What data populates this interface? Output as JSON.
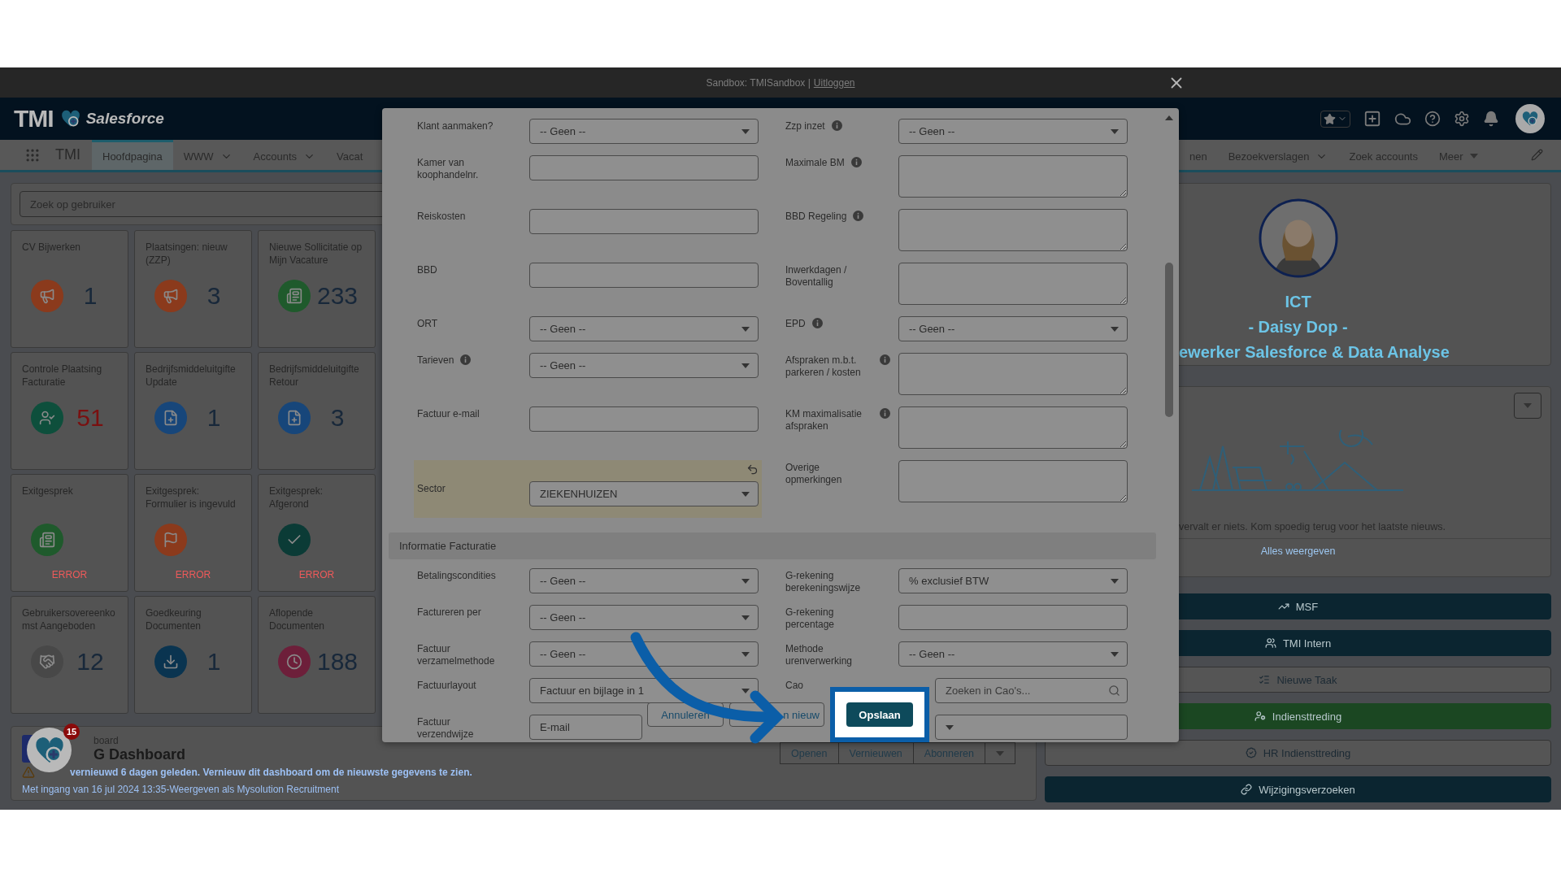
{
  "sandbox_bar": {
    "text": "Sandbox: TMISandbox |",
    "link": "Uitloggen"
  },
  "header": {
    "logo_text": "TMI",
    "logo_product": "Salesforce"
  },
  "nav": {
    "app_name": "TMI",
    "tabs_left": [
      {
        "label": "Hoofdpagina",
        "selected": true,
        "kind": "plain"
      },
      {
        "label": "WWW",
        "selected": false,
        "kind": "dropdown"
      },
      {
        "label": "Accounts",
        "selected": false,
        "kind": "dropdown"
      },
      {
        "label": "Vacat",
        "selected": false,
        "kind": "plain"
      }
    ],
    "tabs_right": [
      {
        "label": "nen",
        "selected": false,
        "kind": "plain"
      },
      {
        "label": "Bezoekverslagen",
        "selected": false,
        "kind": "dropdown"
      },
      {
        "label": "Zoek accounts",
        "selected": false,
        "kind": "plain"
      },
      {
        "label": "Meer",
        "selected": false,
        "kind": "overflow"
      }
    ]
  },
  "search": {
    "placeholder": "Zoek op gebruiker"
  },
  "tiles": [
    {
      "title": "CV Bijwerken",
      "color": "#8b3a1c",
      "value": "1",
      "alert": false
    },
    {
      "title": "Plaatsingen: nieuw (ZZP)",
      "color": "#8b3a1c",
      "value": "3",
      "alert": false
    },
    {
      "title": "Nieuwe Sollicitatie op Mijn Vacature",
      "color": "#1f5a2c",
      "value": "233",
      "alert": false
    },
    {
      "title": "Controle Plaatsing Facturatie",
      "color": "#0e4f3c",
      "value": "51",
      "alert": true
    },
    {
      "title": "Bedrijfsmiddeluitgifte Update",
      "color": "#17467a",
      "value": "1",
      "alert": false
    },
    {
      "title": "Bedrijfsmiddeluitgifte Retour",
      "color": "#17467a",
      "value": "3",
      "alert": false
    },
    {
      "title": "Exitgesprek",
      "color": "#1f5a2c",
      "status": "ERROR",
      "alert": true
    },
    {
      "title": "Exitgesprek: Formulier is ingevuld",
      "color": "#8b3a1c",
      "status": "ERROR",
      "alert": true
    },
    {
      "title": "Exitgesprek: Afgerond",
      "color": "#0b3b36",
      "status": "ERROR",
      "alert": true
    },
    {
      "title": "Gebruikersovereenkomst Aangeboden",
      "color": "#484848",
      "value": "12",
      "alert": false
    },
    {
      "title": "Goedkeuring Documenten",
      "color": "#0a3450",
      "value": "1",
      "alert": false
    },
    {
      "title": "Aflopende Documenten",
      "color": "#6d1f3a",
      "value": "188",
      "alert": false
    }
  ],
  "dashboard": {
    "caption": "board",
    "title": "G Dashboard",
    "warning": "vernieuwd 6 dagen geleden. Vernieuw dit dashboard om de nieuwste gegevens te zien.",
    "note": "Met ingang van 16 jul 2024 13:35-Weergeven als Mysolution Recruitment",
    "buttons": [
      "Openen",
      "Vernieuwen",
      "Abonneren"
    ]
  },
  "bubble": {
    "badge": "15"
  },
  "profile": {
    "department": "ICT",
    "name": "- Daisy Dop -",
    "role": "ewerker Salesforce & Data Analyse"
  },
  "news": {
    "message": "vervalt er niets. Kom spoedig terug voor het laatste nieuws.",
    "link": "Alles weergeven"
  },
  "actions": [
    {
      "label": "MSF",
      "kind": "solid",
      "color": "#0b2530"
    },
    {
      "label": "TMI Intern",
      "kind": "solid",
      "color": "#0b2530"
    },
    {
      "label": "Nieuwe Taak",
      "kind": "outline",
      "color": "#555555"
    },
    {
      "label": "Indiensttreding",
      "kind": "success",
      "color": "#1b4722"
    },
    {
      "label": "HR Indiensttreding",
      "kind": "outline",
      "color": "#555555"
    },
    {
      "label": "Wijzigingsverzoeken",
      "kind": "solid",
      "color": "#0b2530"
    }
  ],
  "modal": {
    "rows": [
      {
        "left": {
          "label": "Klant aanmaken?",
          "kind": "select",
          "value": "-- Geen --",
          "info": false,
          "edited": false
        },
        "right": {
          "label": "Zzp inzet",
          "kind": "select",
          "value": "-- Geen --",
          "info": true,
          "edited": false
        }
      },
      {
        "left": {
          "label": "Kamer van koophandelnr.",
          "kind": "input",
          "info": false,
          "edited": false
        },
        "right": {
          "label": "Maximale BM",
          "kind": "textarea",
          "info": true,
          "edited": false
        }
      },
      {
        "left": {
          "label": "Reiskosten",
          "kind": "input",
          "info": false,
          "edited": false
        },
        "right": {
          "label": "BBD Regeling",
          "kind": "textarea",
          "info": true,
          "edited": false
        }
      },
      {
        "left": {
          "label": "BBD",
          "kind": "input",
          "info": false,
          "edited": false
        },
        "right": {
          "label": "Inwerkdagen / Boventallig",
          "kind": "textarea",
          "info": false,
          "edited": false
        }
      },
      {
        "left": {
          "label": "ORT",
          "kind": "select",
          "value": "-- Geen --",
          "info": false,
          "edited": false
        },
        "right": {
          "label": "EPD",
          "kind": "select",
          "value": "-- Geen --",
          "info": true,
          "edited": false
        }
      },
      {
        "left": {
          "label": "Tarieven",
          "kind": "select",
          "value": "-- Geen --",
          "info": true,
          "edited": false
        },
        "right": {
          "label": "Afspraken m.b.t. parkeren / kosten",
          "kind": "textarea",
          "info": true,
          "edited": false
        }
      },
      {
        "left": {
          "label": "Factuur e-mail",
          "kind": "input",
          "info": false,
          "edited": false
        },
        "right": {
          "label": "KM maximalisatie afspraken",
          "kind": "textarea",
          "info": true,
          "edited": false
        }
      },
      {
        "left": {
          "label": "Sector",
          "kind": "select",
          "value": "ZIEKENHUIZEN",
          "info": false,
          "edited": true
        },
        "right": {
          "label": "Overige opmerkingen",
          "kind": "textarea",
          "info": false,
          "edited": false
        }
      }
    ],
    "section": "Informatie Facturatie",
    "section_rows": [
      {
        "left": {
          "label": "Betalingscondities",
          "kind": "select",
          "value": "-- Geen --",
          "info": false,
          "edited": false
        },
        "right": {
          "label": "G-rekening berekeningswijze",
          "kind": "select",
          "value": "% exclusief BTW",
          "info": false,
          "edited": false
        }
      },
      {
        "left": {
          "label": "Factureren per",
          "kind": "select",
          "value": "-- Geen --",
          "info": false,
          "edited": false
        },
        "right": {
          "label": "G-rekening percentage",
          "kind": "input",
          "info": false,
          "edited": false
        }
      },
      {
        "left": {
          "label": "Factuur verzamelmethode",
          "kind": "select",
          "value": "-- Geen --",
          "info": false,
          "edited": false
        },
        "right": {
          "label": "Methode urenverwerking",
          "kind": "select",
          "value": "-- Geen --",
          "info": false,
          "edited": false
        }
      },
      {
        "left": {
          "label": "Factuurlayout",
          "kind": "select",
          "value": "Factuur en bijlage in 1",
          "info": false,
          "edited": false
        },
        "right": {
          "label": "Cao",
          "kind": "search",
          "placeholder": "Zoeken in Cao's...",
          "info": false,
          "edited": false
        }
      },
      {
        "left": {
          "label": "Factuur verzendwijze",
          "kind": "input",
          "value": "E-mail",
          "info": false,
          "edited": false
        },
        "right": {
          "kind": "select"
        }
      }
    ],
    "buttons": {
      "cancel": "Annuleren",
      "save_new": "n nieuw",
      "save": "Opslaan"
    }
  }
}
